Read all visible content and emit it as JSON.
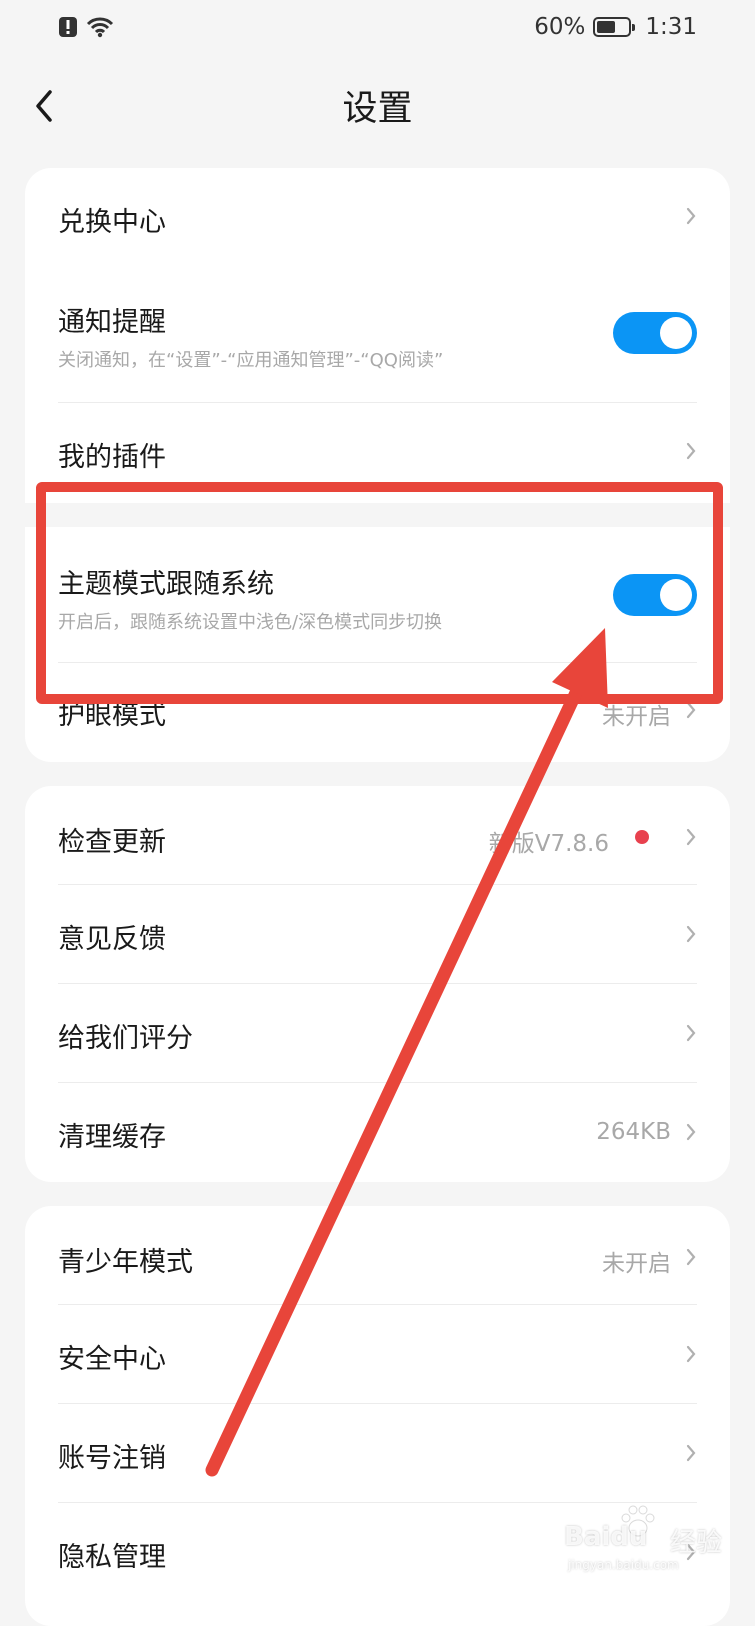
{
  "status_bar": {
    "battery": "60%",
    "time": "1:31",
    "battery_level": 0.6
  },
  "nav": {
    "title": "设置"
  },
  "card1": {
    "exchange_center": "兑换中心",
    "notify_title": "通知提醒",
    "notify_sub": "关闭通知，在“设置”-“应用通知管理”-“QQ阅读”",
    "notify_on": true,
    "plugins": "我的插件",
    "theme_title": "主题模式跟随系统",
    "theme_sub": "开启后，跟随系统设置中浅色/深色模式同步切换",
    "theme_on": true,
    "eye_mode": "护眼模式",
    "eye_mode_value": "未开启"
  },
  "card2": {
    "check_update": "检查更新",
    "check_update_value": "新版V7.8.6",
    "feedback": "意见反馈",
    "rate": "给我们评分",
    "clear_cache": "清理缓存",
    "clear_cache_value": "264KB"
  },
  "card3": {
    "teen_mode": "青少年模式",
    "teen_mode_value": "未开启",
    "security": "安全中心",
    "account_cancel": "账号注销",
    "privacy": "隐私管理"
  },
  "watermark": {
    "brand": "Baidu",
    "brand_cn": "经验",
    "url": "jingyan.baidu.com"
  },
  "colors": {
    "accent": "#0b95f5",
    "annotation": "#e8453a",
    "dot": "#e8414e",
    "background": "#f5f5f5"
  }
}
